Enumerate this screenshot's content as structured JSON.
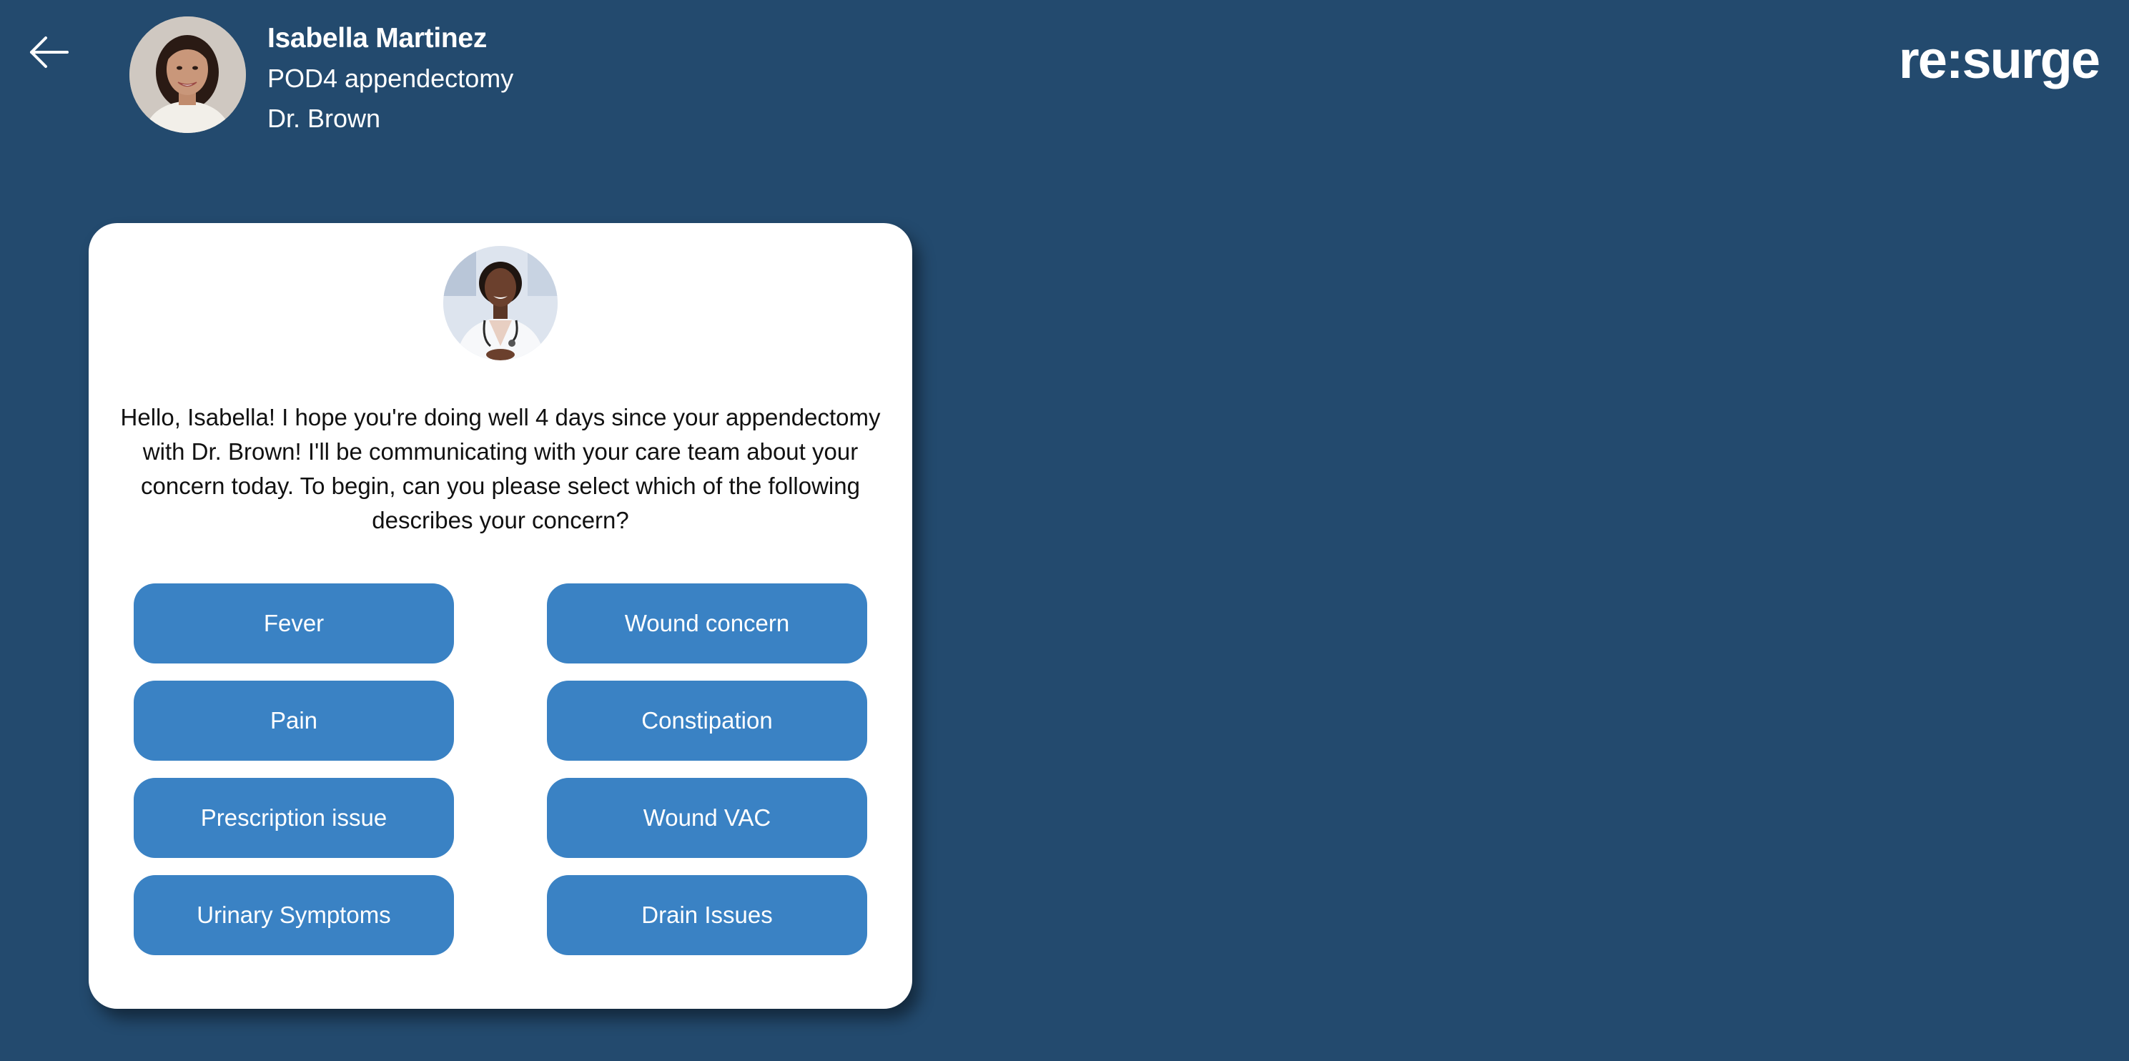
{
  "header": {
    "back_icon": "arrow-left-icon",
    "patient": {
      "avatar": "patient-avatar",
      "name": "Isabella Martinez",
      "procedure": "POD4 appendectomy",
      "doctor": "Dr. Brown"
    },
    "brand": "re:surge"
  },
  "chat": {
    "doctor_avatar": "doctor-avatar",
    "message": "Hello, Isabella! I hope you're doing well 4 days since your appendectomy with Dr. Brown! I'll be communicating with your care team about your concern today. To begin, can you please select which of the following describes your concern?",
    "options": [
      "Fever",
      "Wound concern",
      "Pain",
      "Constipation",
      "Prescription issue",
      "Wound VAC",
      "Urinary Symptoms",
      "Drain Issues"
    ]
  },
  "colors": {
    "background": "#234a6e",
    "card": "#ffffff",
    "button": "#3a82c4",
    "button_text": "#ffffff"
  }
}
